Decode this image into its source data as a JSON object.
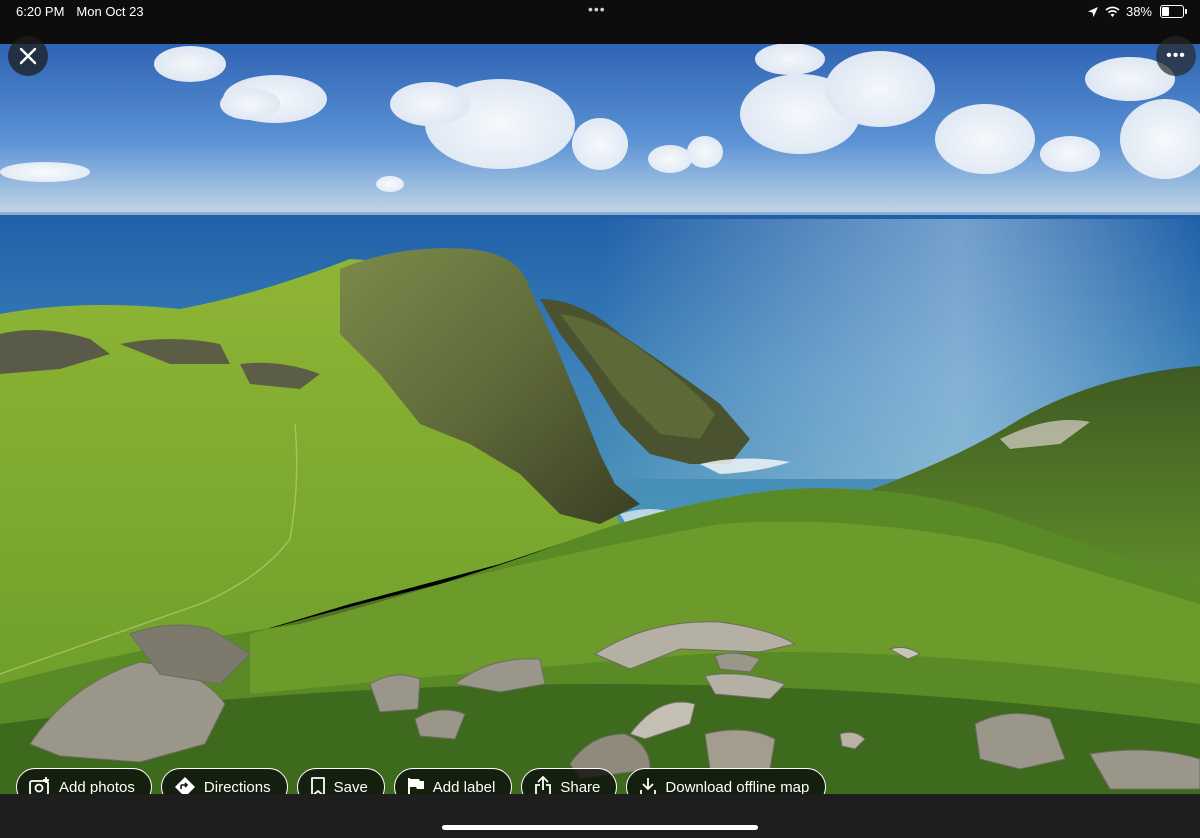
{
  "status_bar": {
    "time": "6:20 PM",
    "date": "Mon Oct 23",
    "battery_percent": "38%",
    "battery_level": 0.38
  },
  "photo": {
    "description_icon": "landscape-photo"
  },
  "actions": [
    {
      "label": "Add photos",
      "icon": "add-photo-icon"
    },
    {
      "label": "Directions",
      "icon": "directions-icon"
    },
    {
      "label": "Save",
      "icon": "bookmark-icon"
    },
    {
      "label": "Add label",
      "icon": "flag-icon"
    },
    {
      "label": "Share",
      "icon": "share-icon"
    },
    {
      "label": "Download offline map",
      "icon": "download-icon"
    }
  ],
  "colors": {
    "chip_border": "#ffffff",
    "chip_background": "#0a0a0a"
  }
}
